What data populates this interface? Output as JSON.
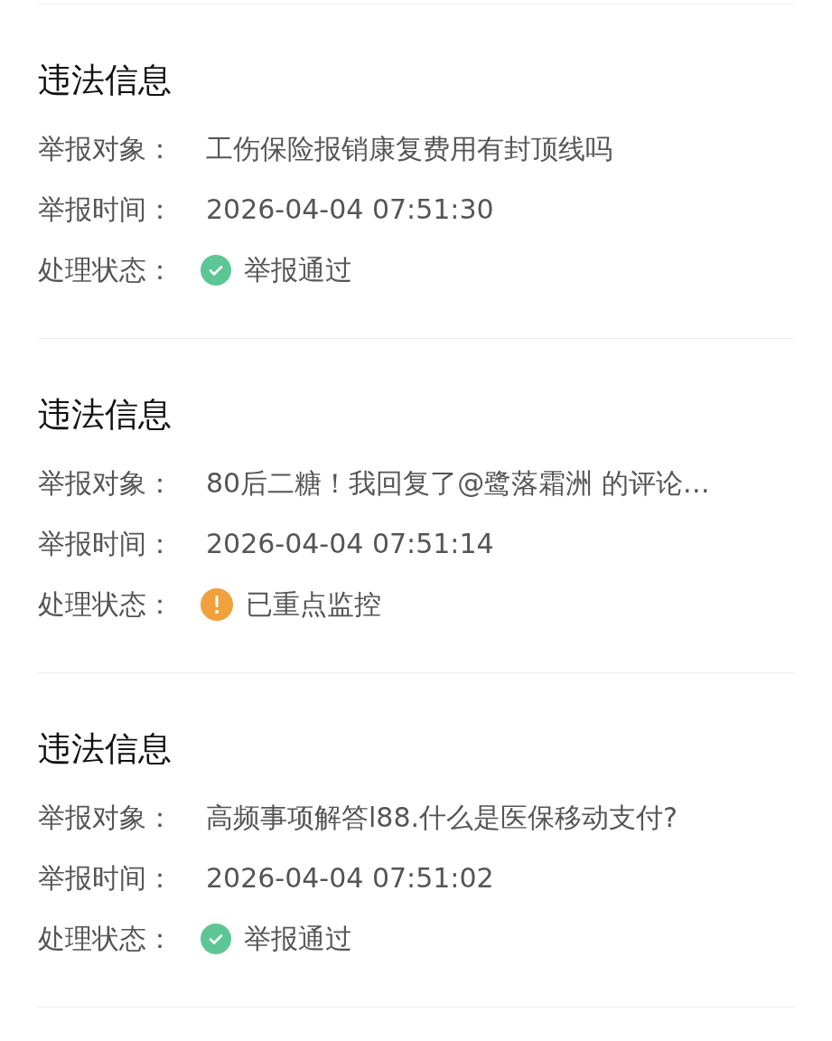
{
  "reports": [
    {
      "title": "违法信息",
      "fields": [
        {
          "label": "举报对象：",
          "value": "工伤保险报销康复费用有封顶线吗"
        },
        {
          "label": "举报时间：",
          "value": "2026-04-04 07:51:30"
        }
      ],
      "status": {
        "label": "处理状态：",
        "kind": "passed",
        "value": "举报通过"
      }
    },
    {
      "title": "违法信息",
      "fields": [
        {
          "label": "举报对象：",
          "value": "80后二糖！我回复了@鹭落霜洲 的评论…"
        },
        {
          "label": "举报时间：",
          "value": "2026-04-04 07:51:14"
        }
      ],
      "status": {
        "label": "处理状态：",
        "kind": "monitored",
        "value": "已重点监控"
      }
    },
    {
      "title": "违法信息",
      "fields": [
        {
          "label": "举报对象：",
          "value": "高频事项解答l88.什么是医保移动支付?"
        },
        {
          "label": "举报时间：",
          "value": "2026-04-04 07:51:02"
        }
      ],
      "status": {
        "label": "处理状态：",
        "kind": "passed",
        "value": "举报通过"
      }
    }
  ]
}
